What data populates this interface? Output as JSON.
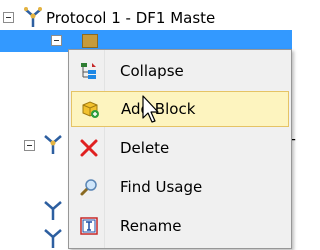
{
  "tree": {
    "row1_label": "Protocol 1 - DF1 Maste",
    "right_fragment": "T"
  },
  "context_menu": {
    "items": [
      {
        "label": "Collapse",
        "icon": "collapse-icon"
      },
      {
        "label": "Add Block",
        "icon": "add-block-icon",
        "highlighted": true
      },
      {
        "label": "Delete",
        "icon": "delete-icon"
      },
      {
        "label": "Find Usage",
        "icon": "find-usage-icon"
      },
      {
        "label": "Rename",
        "icon": "rename-icon"
      }
    ]
  },
  "colors": {
    "selection": "#3399ff",
    "menu_bg": "#f0f0f0",
    "highlight_bg": "#fdf4bf",
    "highlight_border": "#e5c365",
    "delete_red": "#e02020"
  }
}
